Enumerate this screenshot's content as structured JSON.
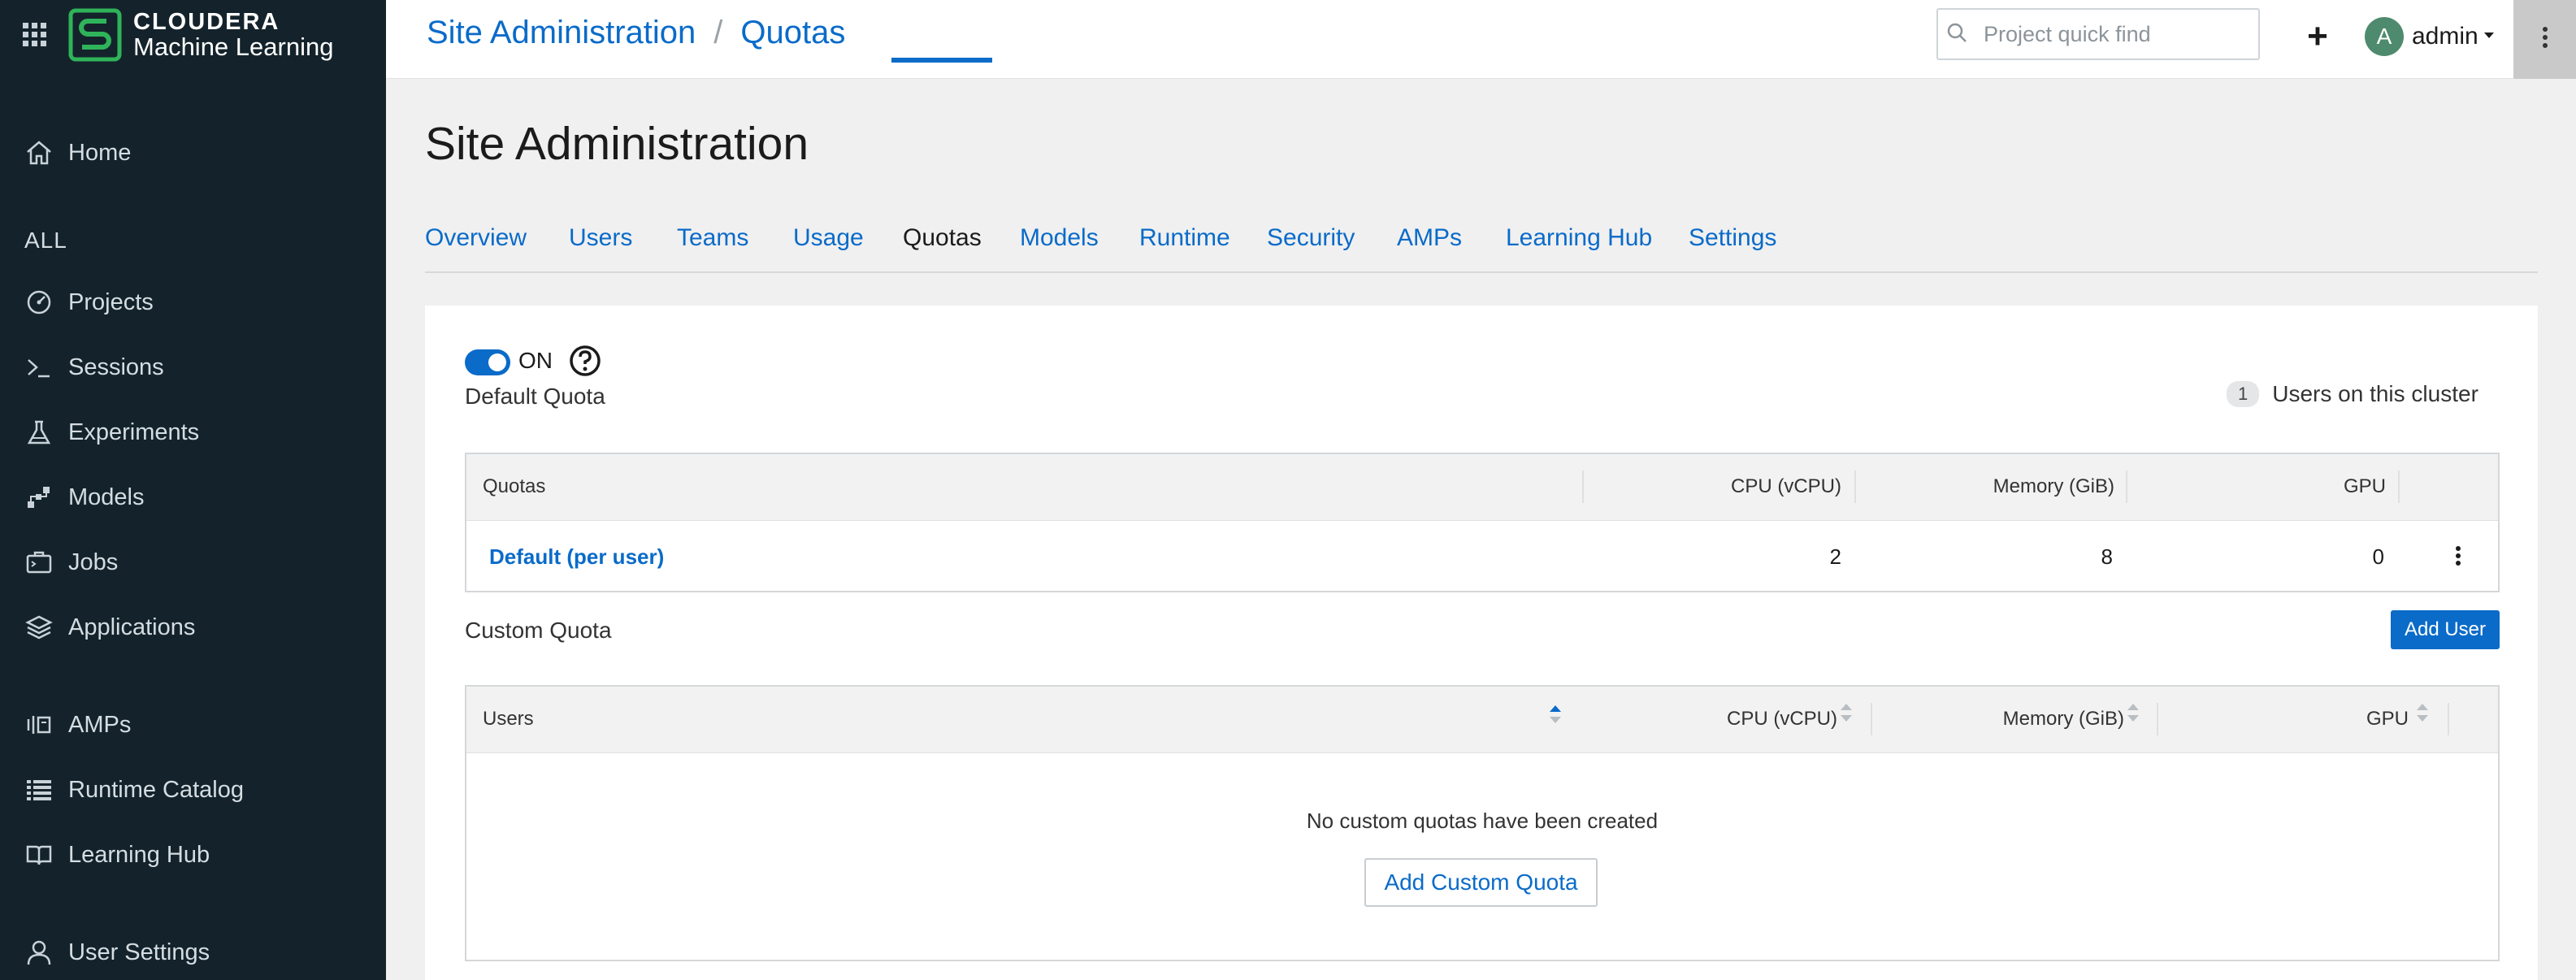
{
  "app": {
    "brand_top": "CLOUDERA",
    "brand_bottom": "Machine Learning"
  },
  "sidebar": {
    "section_label": "ALL",
    "items": [
      {
        "label": "Home",
        "icon": "home-icon"
      },
      {
        "label": "Projects",
        "icon": "gauge-icon"
      },
      {
        "label": "Sessions",
        "icon": "terminal-icon"
      },
      {
        "label": "Experiments",
        "icon": "flask-icon"
      },
      {
        "label": "Models",
        "icon": "models-icon"
      },
      {
        "label": "Jobs",
        "icon": "jobs-icon"
      },
      {
        "label": "Applications",
        "icon": "layers-icon"
      },
      {
        "label": "AMPs",
        "icon": "amps-icon"
      },
      {
        "label": "Runtime Catalog",
        "icon": "list-icon"
      },
      {
        "label": "Learning Hub",
        "icon": "book-icon"
      },
      {
        "label": "User Settings",
        "icon": "user-icon"
      }
    ]
  },
  "header": {
    "breadcrumb": [
      "Site Administration",
      "Quotas"
    ],
    "breadcrumb_sep": "/",
    "search_placeholder": "Project quick find",
    "plus_label": "+",
    "user_initial": "A",
    "user_name": "admin"
  },
  "page": {
    "title": "Site Administration",
    "tabs": [
      "Overview",
      "Users",
      "Teams",
      "Usage",
      "Quotas",
      "Models",
      "Runtime",
      "Security",
      "AMPs",
      "Learning Hub",
      "Settings"
    ],
    "active_tab": "Quotas"
  },
  "quotas": {
    "toggle_label": "ON",
    "toggle_on": true,
    "default_title": "Default Quota",
    "users_count": "1",
    "users_count_label": "Users on this cluster",
    "default_table": {
      "headers": [
        "Quotas",
        "CPU (vCPU)",
        "Memory (GiB)",
        "GPU"
      ],
      "rows": [
        {
          "name": "Default (per user)",
          "cpu": "2",
          "memory": "8",
          "gpu": "0"
        }
      ]
    },
    "custom_title": "Custom Quota",
    "add_user_label": "Add User",
    "custom_table": {
      "headers": [
        "Users",
        "CPU (vCPU)",
        "Memory (GiB)",
        "GPU"
      ],
      "empty_message": "No custom quotas have been created",
      "add_custom_label": "Add Custom Quota"
    }
  },
  "colors": {
    "sidebar_bg": "#14232b",
    "accent": "#0a6bc9",
    "logo_green": "#2fb35a"
  }
}
